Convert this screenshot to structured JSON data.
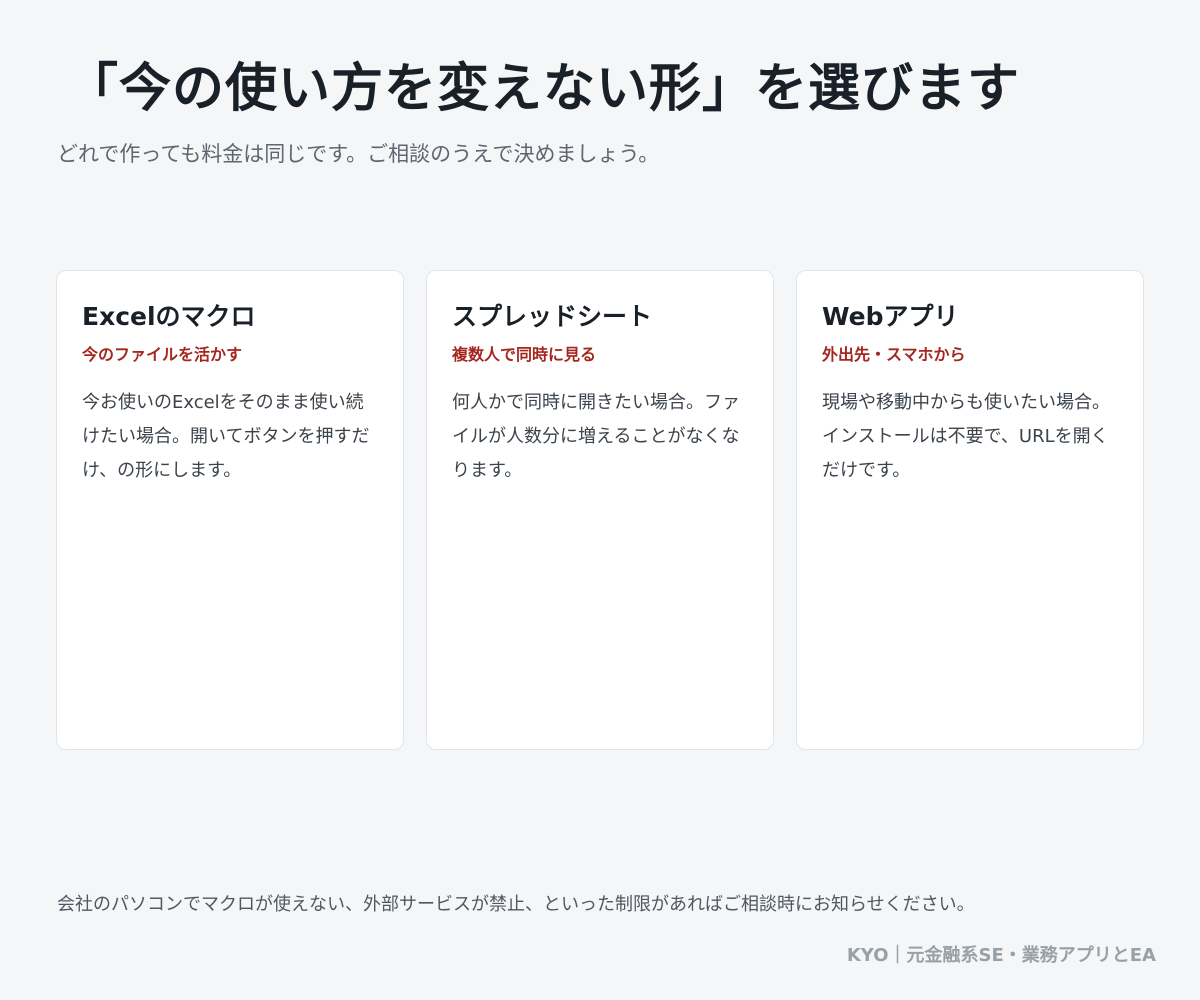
{
  "header": {
    "title": "「今の使い方を変えない形」を選びます",
    "subtitle": "どれで作っても料金は同じです。ご相談のうえで決めましょう。"
  },
  "cards": [
    {
      "title": "Excelのマクロ",
      "tagline": "今のファイルを活かす",
      "body": "今お使いのExcelをそのまま使い続けたい場合。開いてボタンを押すだけ、の形にします。"
    },
    {
      "title": "スプレッドシート",
      "tagline": "複数人で同時に見る",
      "body": "何人かで同時に開きたい場合。ファイルが人数分に増えることがなくなります。"
    },
    {
      "title": "Webアプリ",
      "tagline": "外出先・スマホから",
      "body": "現場や移動中からも使いたい場合。インストールは不要で、URLを開くだけです。"
    }
  ],
  "footer": {
    "note": "会社のパソコンでマクロが使えない、外部サービスが禁止、といった制限があればご相談時にお知らせください。",
    "credit": "KYO｜元金融系SE・業務アプリとEA"
  },
  "colors": {
    "background": "#f4f6f8",
    "accent_red": "#a4271f",
    "title_text": "#1a2027",
    "muted_text": "#98a0a8"
  }
}
